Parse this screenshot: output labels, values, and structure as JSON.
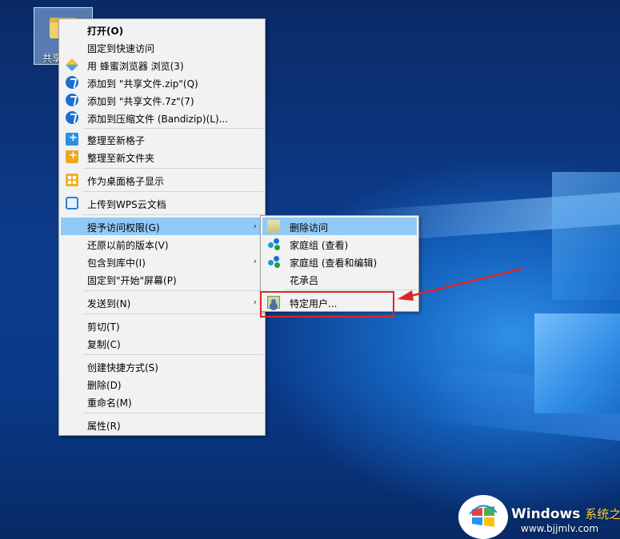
{
  "desktop_icon": {
    "label": "共享文件"
  },
  "context_menu": {
    "items": [
      {
        "label": "打开(O)",
        "icon": "none",
        "bold": true
      },
      {
        "label": "固定到快速访问",
        "icon": "none"
      },
      {
        "label": "用 蜂蜜浏览器 浏览(3)",
        "icon": "honeyview-icon"
      },
      {
        "label": "添加到 \"共享文件.zip\"(Q)",
        "icon": "bandizip-icon"
      },
      {
        "label": "添加到 \"共享文件.7z\"(7)",
        "icon": "bandizip-icon"
      },
      {
        "label": "添加到压缩文件 (Bandizip)(L)...",
        "icon": "bandizip-icon"
      },
      {
        "label": "整理至新格子",
        "icon": "add-box-blue-icon"
      },
      {
        "label": "整理至新文件夹",
        "icon": "add-box-yellow-icon"
      },
      {
        "label": "作为桌面格子显示",
        "icon": "desktop-grid-icon"
      },
      {
        "label": "上传到WPS云文档",
        "icon": "wps-cloud-icon"
      },
      {
        "label": "授予访问权限(G)",
        "icon": "none",
        "submenu": true,
        "highlighted": true
      },
      {
        "label": "还原以前的版本(V)",
        "icon": "none"
      },
      {
        "label": "包含到库中(I)",
        "icon": "none",
        "submenu": true
      },
      {
        "label": "固定到\"开始\"屏幕(P)",
        "icon": "none"
      },
      {
        "label": "发送到(N)",
        "icon": "none",
        "submenu": true
      },
      {
        "label": "剪切(T)",
        "icon": "none"
      },
      {
        "label": "复制(C)",
        "icon": "none"
      },
      {
        "label": "创建快捷方式(S)",
        "icon": "none"
      },
      {
        "label": "删除(D)",
        "icon": "none"
      },
      {
        "label": "重命名(M)",
        "icon": "none"
      },
      {
        "label": "属性(R)",
        "icon": "none"
      }
    ],
    "submenu_arrow": "›"
  },
  "share_submenu": {
    "items": [
      {
        "label": "删除访问",
        "icon": "lock-icon",
        "highlighted": true
      },
      {
        "label": "家庭组 (查看)",
        "icon": "homegroup-icon"
      },
      {
        "label": "家庭组 (查看和编辑)",
        "icon": "homegroup-icon"
      },
      {
        "label": "花承吕",
        "icon": "none"
      },
      {
        "label": "特定用户...",
        "icon": "user-icon"
      }
    ]
  },
  "annotation": {
    "color": "#e02424"
  },
  "watermark": {
    "title": "Windows",
    "title_cn": "系统之家",
    "url": "www.bjjmlv.com"
  },
  "colors": {
    "menu_bg": "#f2f2f2",
    "highlight": "#91c9f7",
    "desktop": "#0d3c8c"
  }
}
